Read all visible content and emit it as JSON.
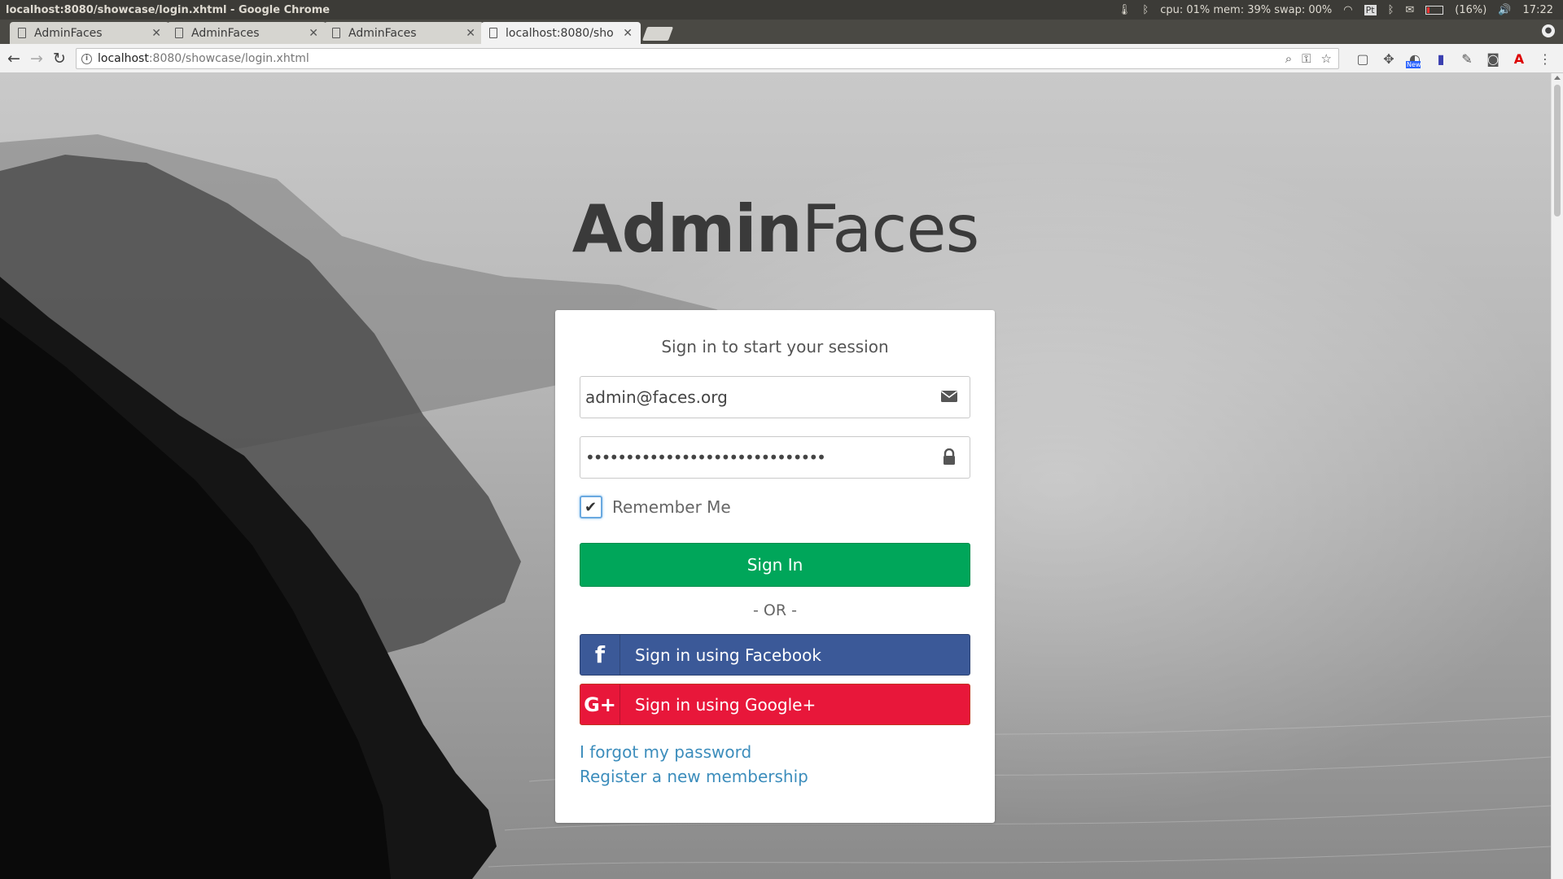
{
  "os_bar": {
    "window_title": "localhost:8080/showcase/login.xhtml - Google Chrome",
    "status_text": "cpu: 01% mem: 39% swap: 00%",
    "keyboard_layout": "Pt",
    "battery": "(16%)",
    "battery_level_percent": 16,
    "clock": "17:22"
  },
  "tabs": [
    {
      "label": "AdminFaces",
      "active": false
    },
    {
      "label": "AdminFaces",
      "active": false
    },
    {
      "label": "AdminFaces",
      "active": false
    },
    {
      "label": "localhost:8080/sho",
      "active": true
    }
  ],
  "toolbar": {
    "url_host": "localhost",
    "url_rest": ":8080/showcase/login.xhtml",
    "ext_badge": "New"
  },
  "login": {
    "brand_bold": "Admin",
    "brand_thin": "Faces",
    "message": "Sign in to start your session",
    "email_value": "admin@faces.org",
    "password_value": "••••••••••••••••••••••••••••••",
    "remember_label": "Remember Me",
    "remember_checked": true,
    "signin_label": "Sign In",
    "or_label": "- OR -",
    "facebook_label": "Sign in using Facebook",
    "google_label": "Sign in using Google+",
    "forgot_label": "I forgot my password",
    "register_label": "Register a new membership"
  },
  "colors": {
    "signin_green": "#00a65a",
    "facebook_blue": "#3b5998",
    "google_red": "#e8173a",
    "link_blue": "#3c8dbc"
  }
}
